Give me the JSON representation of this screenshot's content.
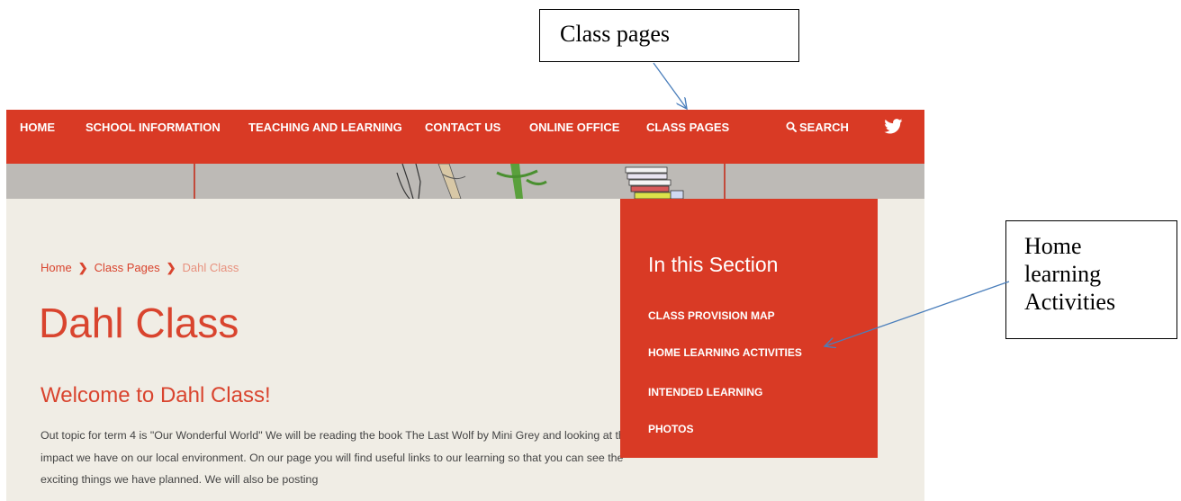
{
  "annotations": {
    "class_pages_label": "Class pages",
    "home_learning_lines": [
      "Home",
      "learning",
      "Activities"
    ]
  },
  "nav": {
    "items": [
      "HOME",
      "SCHOOL INFORMATION",
      "TEACHING AND LEARNING",
      "CONTACT US",
      "ONLINE OFFICE",
      "CLASS PAGES"
    ],
    "search_label": "SEARCH",
    "search_icon": "search-icon",
    "social_icon": "twitter-icon"
  },
  "breadcrumb": [
    "Home",
    "Class Pages",
    "Dahl Class"
  ],
  "page": {
    "title": "Dahl Class",
    "welcome": "Welcome to Dahl Class!",
    "body": "Out topic for term 4 is \"Our Wonderful World\" We will be reading the book The Last Wolf by Mini Grey and looking at the impact we have on our local environment. On our page you will find useful links to our learning so that you can see the exciting things we have planned. We will also be posting"
  },
  "sidebar": {
    "title": "In this Section",
    "links": [
      "CLASS PROVISION MAP",
      "HOME LEARNING ACTIVITIES",
      "INTENDED LEARNING",
      "PHOTOS"
    ]
  },
  "colors": {
    "brand_red": "#d93a25",
    "page_bg": "#f0ede5",
    "annotation_arrow": "#4a7ebb"
  }
}
